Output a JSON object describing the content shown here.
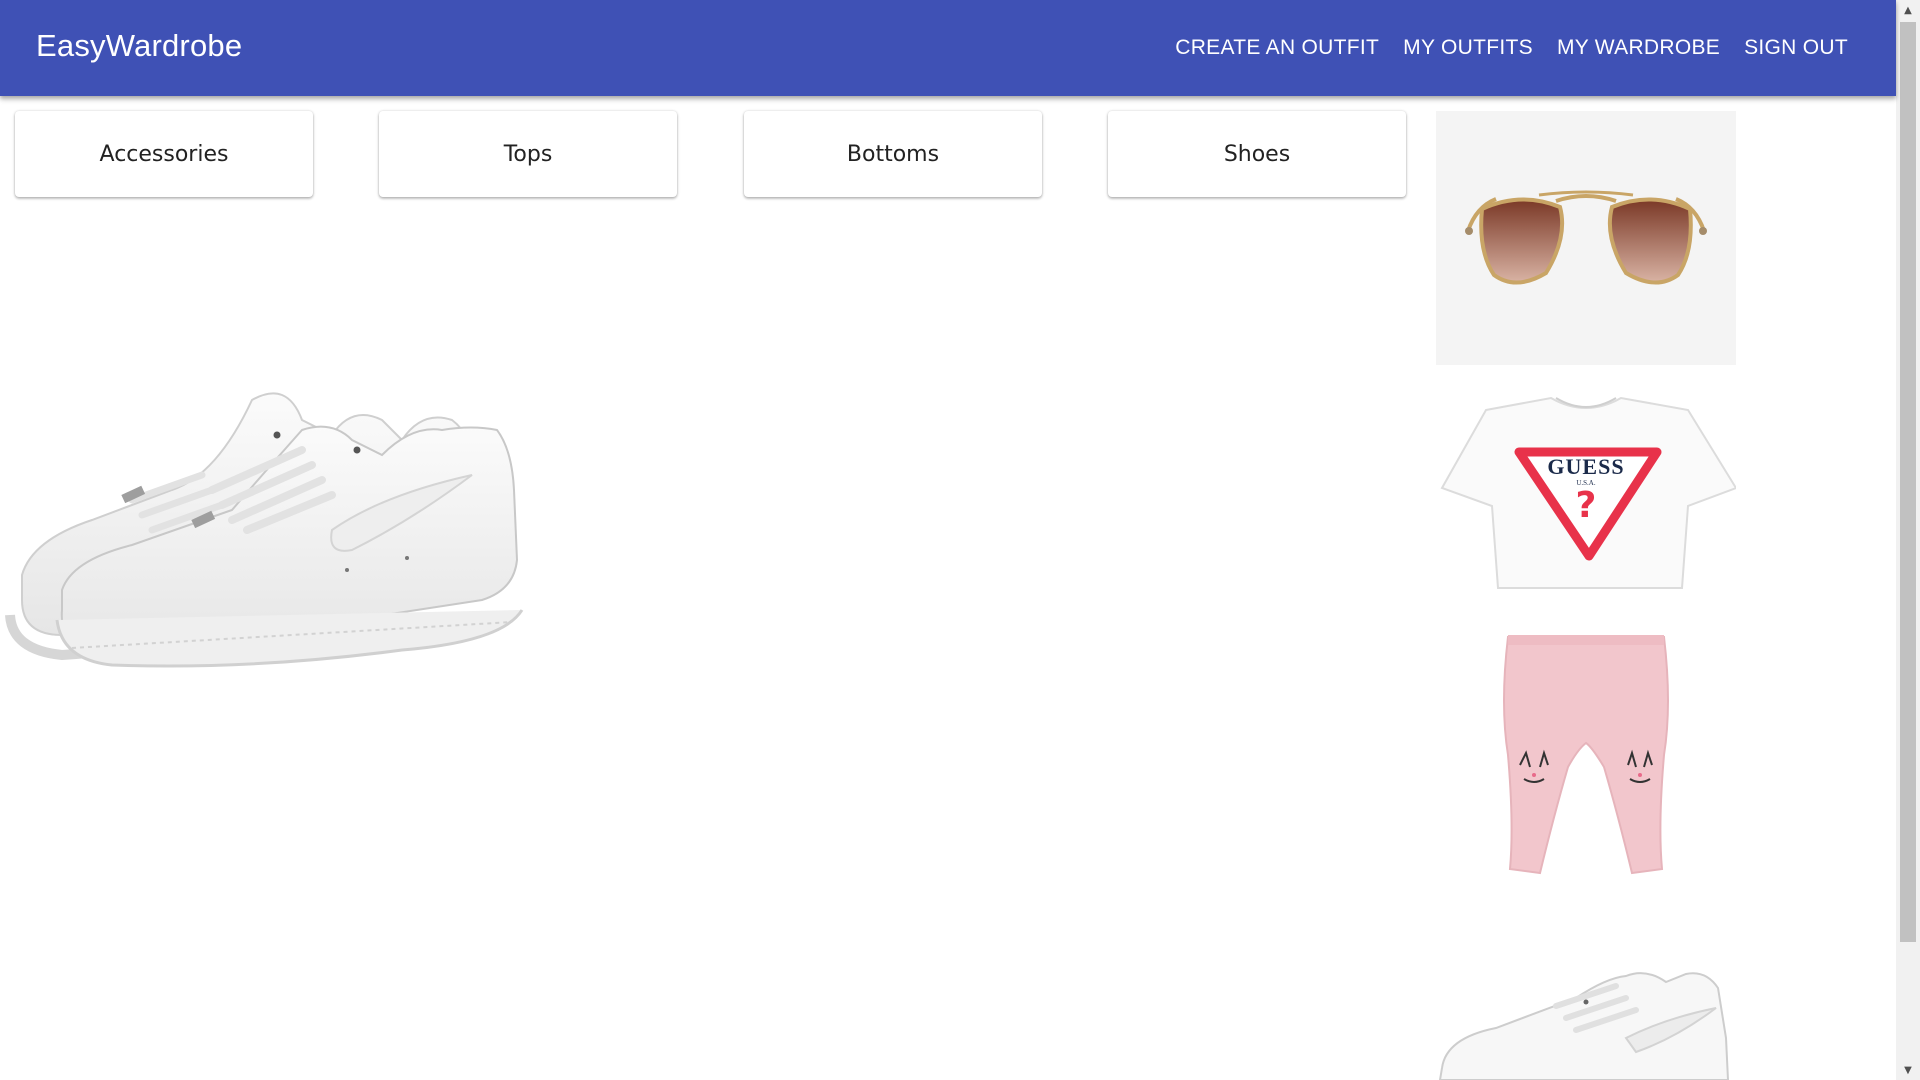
{
  "app": {
    "title": "EasyWardrobe"
  },
  "nav": {
    "create_outfit": "CREATE AN OUTFIT",
    "my_outfits": "MY OUTFITS",
    "my_wardrobe": "MY WARDROBE",
    "sign_out": "SIGN OUT"
  },
  "categories": [
    "Accessories",
    "Tops",
    "Bottoms",
    "Shoes"
  ],
  "canvas": {
    "placed_item": "white-sneaker-image"
  },
  "wardrobe_items": [
    {
      "icon": "sunglasses-image",
      "category": "Accessories"
    },
    {
      "icon": "tshirt-image",
      "category": "Tops"
    },
    {
      "icon": "leggings-image",
      "category": "Bottoms"
    },
    {
      "icon": "sneaker-image",
      "category": "Shoes"
    }
  ],
  "colors": {
    "appbar": "#3f51b5",
    "appbar_text": "#ffffff",
    "logo_red": "#e8324a",
    "leggings_pink": "#f2c6cc",
    "lens_brown": "#8a4a36",
    "frame_gold": "#c9a566"
  },
  "product_text": {
    "guess_brand": "GUESS",
    "guess_sub": "U.S.A.",
    "guess_mark": "?"
  }
}
